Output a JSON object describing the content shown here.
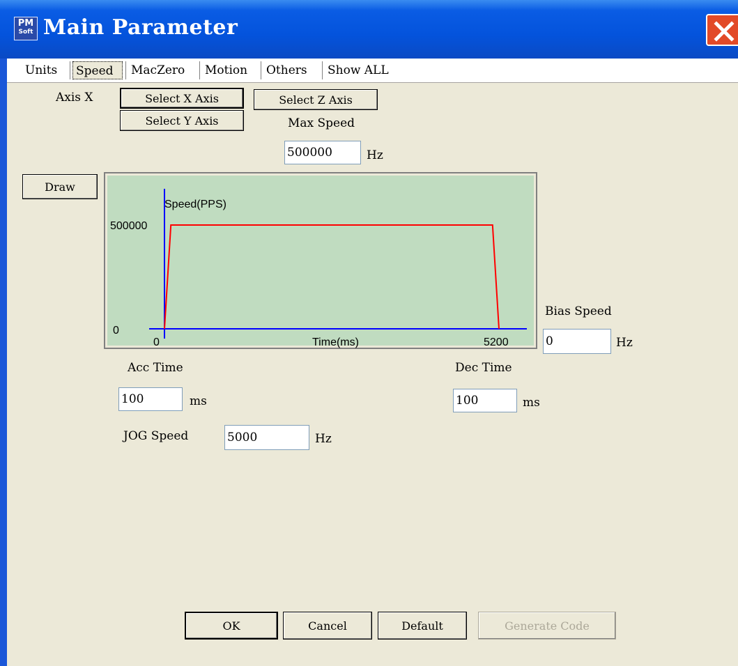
{
  "window": {
    "title": "Main Parameter",
    "app_icon_top": "PM",
    "app_icon_bottom": "Soft"
  },
  "tabs": [
    {
      "label": "Units",
      "active": false
    },
    {
      "label": "Speed",
      "active": true
    },
    {
      "label": "MacZero",
      "active": false
    },
    {
      "label": "Motion",
      "active": false
    },
    {
      "label": "Others",
      "active": false
    },
    {
      "label": "Show ALL",
      "active": false
    }
  ],
  "axis": {
    "label": "Axis X",
    "select_x": "Select X Axis",
    "select_y": "Select Y Axis",
    "select_z": "Select Z Axis"
  },
  "max_speed": {
    "label": "Max Speed",
    "value": "500000",
    "unit": "Hz"
  },
  "draw_button": "Draw",
  "bias_speed": {
    "label": "Bias Speed",
    "value": "0",
    "unit": "Hz"
  },
  "acc_time": {
    "label": "Acc Time",
    "value": "100",
    "unit": "ms"
  },
  "dec_time": {
    "label": "Dec Time",
    "value": "100",
    "unit": "ms"
  },
  "jog_speed": {
    "label": "JOG Speed",
    "value": "5000",
    "unit": "Hz"
  },
  "buttons": {
    "ok": "OK",
    "cancel": "Cancel",
    "default": "Default",
    "generate": "Generate Code"
  },
  "colors": {
    "plot_bg": "#c0dcc0",
    "axis": "#0000ff",
    "curve": "#ff0000",
    "title_bar": "#0453dc"
  },
  "chart_data": {
    "type": "line",
    "ylabel": "Speed(PPS)",
    "xlabel": "Time(ms)",
    "y_ticks": [
      "500000",
      "0"
    ],
    "x_ticks": [
      "0",
      "5200"
    ],
    "xlim": [
      0,
      5200
    ],
    "ylim": [
      0,
      500000
    ],
    "series": [
      {
        "x": [
          0,
          100,
          5100,
          5200
        ],
        "y": [
          0,
          500000,
          500000,
          0
        ]
      }
    ]
  }
}
